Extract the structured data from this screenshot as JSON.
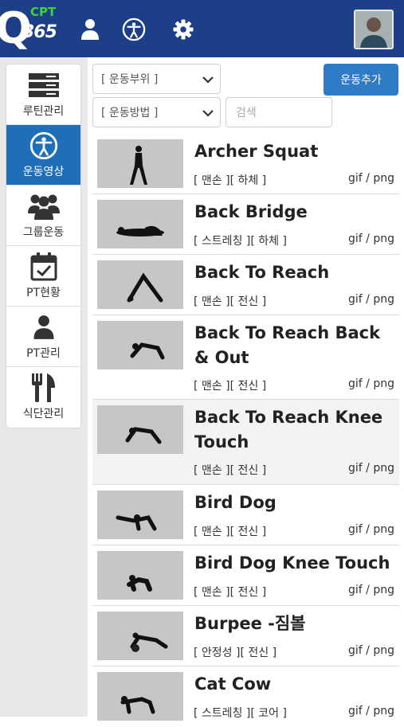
{
  "header": {
    "logo_letter": "Q",
    "logo_number": "365",
    "logo_badge": "CPT",
    "icons": [
      "user-icon",
      "accessibility-icon",
      "gear-icon"
    ]
  },
  "sidebar": {
    "items": [
      {
        "label": "루틴관리",
        "icon": "routine-icon",
        "active": false
      },
      {
        "label": "운동영상",
        "icon": "accessibility-icon",
        "active": true
      },
      {
        "label": "그룹운동",
        "icon": "group-icon",
        "active": false
      },
      {
        "label": "PT현황",
        "icon": "calendar-check-icon",
        "active": false
      },
      {
        "label": "PT관리",
        "icon": "user-icon",
        "active": false
      },
      {
        "label": "식단관리",
        "icon": "utensils-icon",
        "active": false
      }
    ]
  },
  "filters": {
    "body_part": "[ 운동부위 ]",
    "method": "[ 운동방법 ]",
    "search_placeholder": "검색",
    "add_button": "운동추가"
  },
  "exercises": [
    {
      "name": "Archer Squat",
      "tags": "[ 맨손 ][ 하체 ]",
      "format": "gif / png"
    },
    {
      "name": "Back Bridge",
      "tags": "[ 스트레칭 ][ 하체 ]",
      "format": "gif / png"
    },
    {
      "name": "Back To Reach",
      "tags": "[ 맨손 ][ 전신 ]",
      "format": "gif / png"
    },
    {
      "name": "Back To Reach Back & Out",
      "tags": "[ 맨손 ][ 전신 ]",
      "format": "gif / png"
    },
    {
      "name": "Back To Reach Knee Touch",
      "tags": "[ 맨손 ][ 전신 ]",
      "format": "gif / png"
    },
    {
      "name": "Bird Dog",
      "tags": "[ 맨손 ][ 전신 ]",
      "format": "gif / png"
    },
    {
      "name": "Bird Dog Knee Touch",
      "tags": "[ 맨손 ][ 전신 ]",
      "format": "gif / png"
    },
    {
      "name": "Burpee -짐볼",
      "tags": "[ 안정성 ][ 전신 ]",
      "format": "gif / png"
    },
    {
      "name": "Cat Cow",
      "tags": "[ 스트레칭 ][ 코어 ]",
      "format": "gif / png"
    }
  ],
  "colors": {
    "header_bg": "#1d3f87",
    "accent": "#1f6fb8",
    "badge_green": "#3fd13f"
  }
}
